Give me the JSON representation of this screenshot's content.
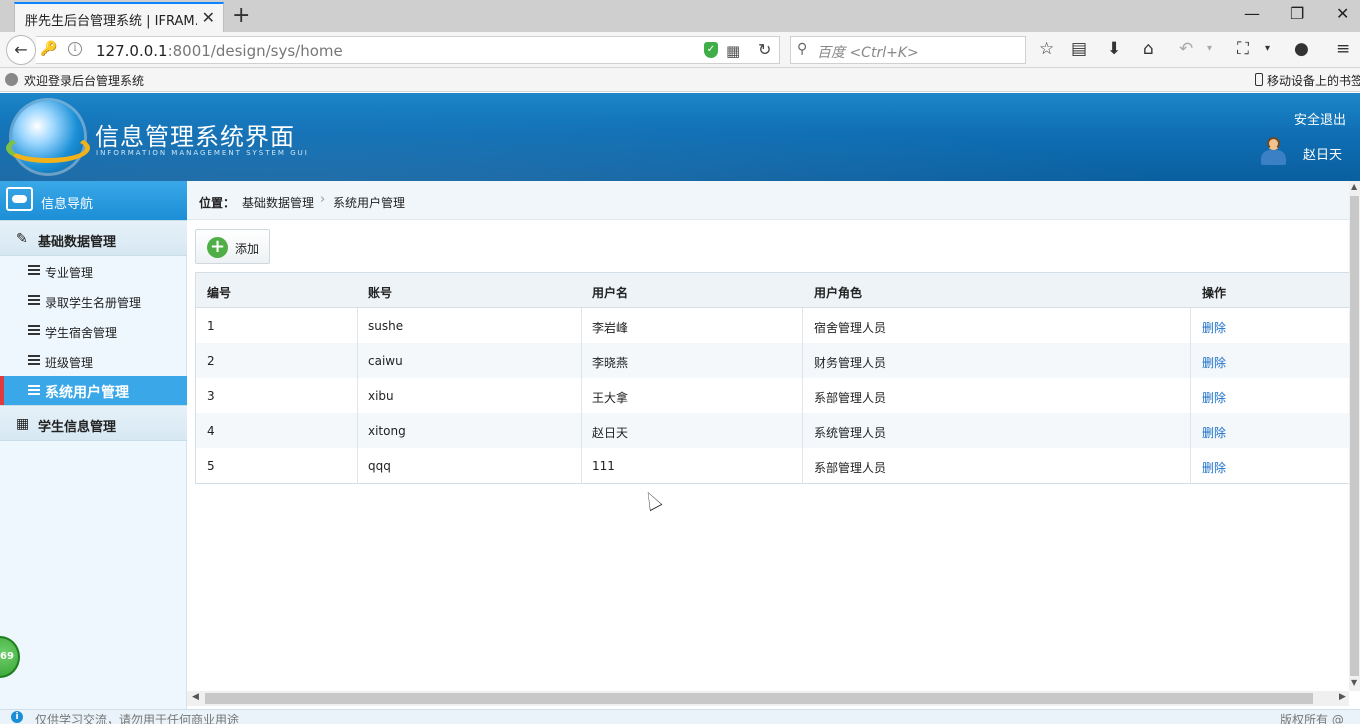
{
  "browser": {
    "tab_title": "胖先生后台管理系统 | IFRAM...",
    "url_host": "127.0.0.1",
    "url_rest": ":8001/design/sys/home",
    "search_placeholder": "百度 <Ctrl+K>",
    "bookmark_left": "欢迎登录后台管理系统",
    "bookmark_right": "移动设备上的书签"
  },
  "header": {
    "title": "信息管理系统界面",
    "subtitle": "INFORMATION MANAGEMENT SYSTEM GUI",
    "logout": "安全退出",
    "user": "赵日天"
  },
  "sidebar": {
    "title": "信息导航",
    "groups": [
      {
        "label": "基础数据管理",
        "icon": "edit-icon"
      },
      {
        "label": "学生信息管理",
        "icon": "calendar-icon"
      }
    ],
    "items": [
      {
        "label": "专业管理",
        "active": false
      },
      {
        "label": "录取学生名册管理",
        "active": false
      },
      {
        "label": "学生宿舍管理",
        "active": false
      },
      {
        "label": "班级管理",
        "active": false
      },
      {
        "label": "系统用户管理",
        "active": true
      }
    ]
  },
  "breadcrumb": {
    "prefix": "位置：",
    "items": [
      "基础数据管理",
      "系统用户管理"
    ]
  },
  "toolbar": {
    "add_label": "添加"
  },
  "table": {
    "headers": [
      "编号",
      "账号",
      "用户名",
      "用户角色",
      "操作"
    ],
    "rows": [
      {
        "id": "1",
        "account": "sushe",
        "username": "李岩峰",
        "role": "宿舍管理人员",
        "action": "删除"
      },
      {
        "id": "2",
        "account": "caiwu",
        "username": "李晓燕",
        "role": "财务管理人员",
        "action": "删除"
      },
      {
        "id": "3",
        "account": "xibu",
        "username": "王大拿",
        "role": "系部管理人员",
        "action": "删除"
      },
      {
        "id": "4",
        "account": "xitong",
        "username": "赵日天",
        "role": "系统管理人员",
        "action": "删除"
      },
      {
        "id": "5",
        "account": "qqq",
        "username": "111",
        "role": "系部管理人员",
        "action": "删除"
      }
    ]
  },
  "footer": {
    "left": "仅供学习交流，请勿用于任何商业用途",
    "right": "版权所有 @"
  },
  "badge": "69",
  "colors": {
    "accent": "#1c8ed6",
    "active_marker": "#e03a3a",
    "link": "#1a6fc9"
  }
}
